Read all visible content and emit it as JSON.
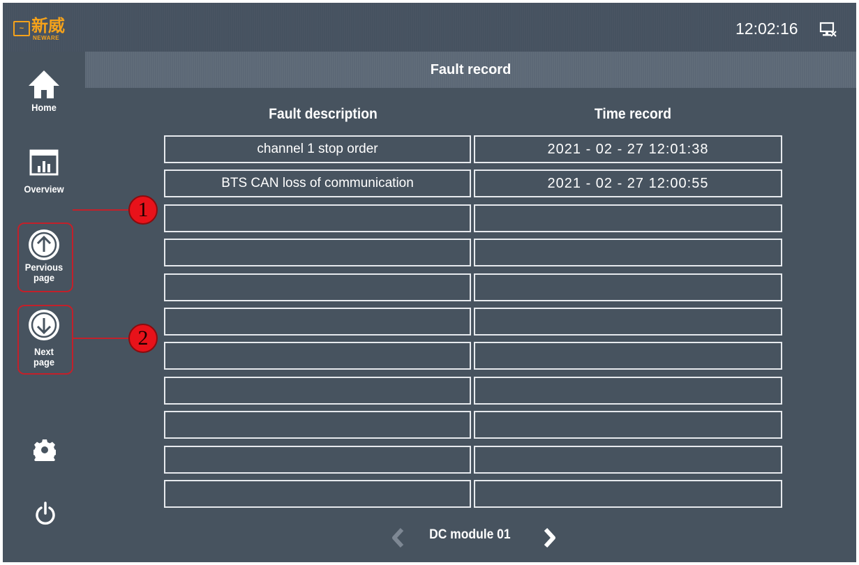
{
  "header": {
    "logo_cn": "新威",
    "logo_en": "NEWARE",
    "clock": "12:02:16"
  },
  "sidebar": {
    "home_label": "Home",
    "overview_label": "Overview",
    "prev_label_1": "Pervious",
    "prev_label_2": "page",
    "next_label_1": "Next",
    "next_label_2": "page"
  },
  "main": {
    "title": "Fault record",
    "columns": [
      "Fault description",
      "Time record"
    ],
    "rows": [
      [
        "channel 1 stop order",
        "2021 - 02 - 27  12:01:38"
      ],
      [
        "BTS CAN loss of communication",
        "2021 - 02 - 27  12:00:55"
      ],
      [
        "",
        ""
      ],
      [
        "",
        ""
      ],
      [
        "",
        ""
      ],
      [
        "",
        ""
      ],
      [
        "",
        ""
      ],
      [
        "",
        ""
      ],
      [
        "",
        ""
      ],
      [
        "",
        ""
      ],
      [
        "",
        ""
      ]
    ],
    "module_label": "DC module 01"
  },
  "callouts": [
    "1",
    "2"
  ],
  "colors": {
    "background": "#47535f",
    "accent_logo": "#f5a21a",
    "callout_red": "#e8121a"
  }
}
